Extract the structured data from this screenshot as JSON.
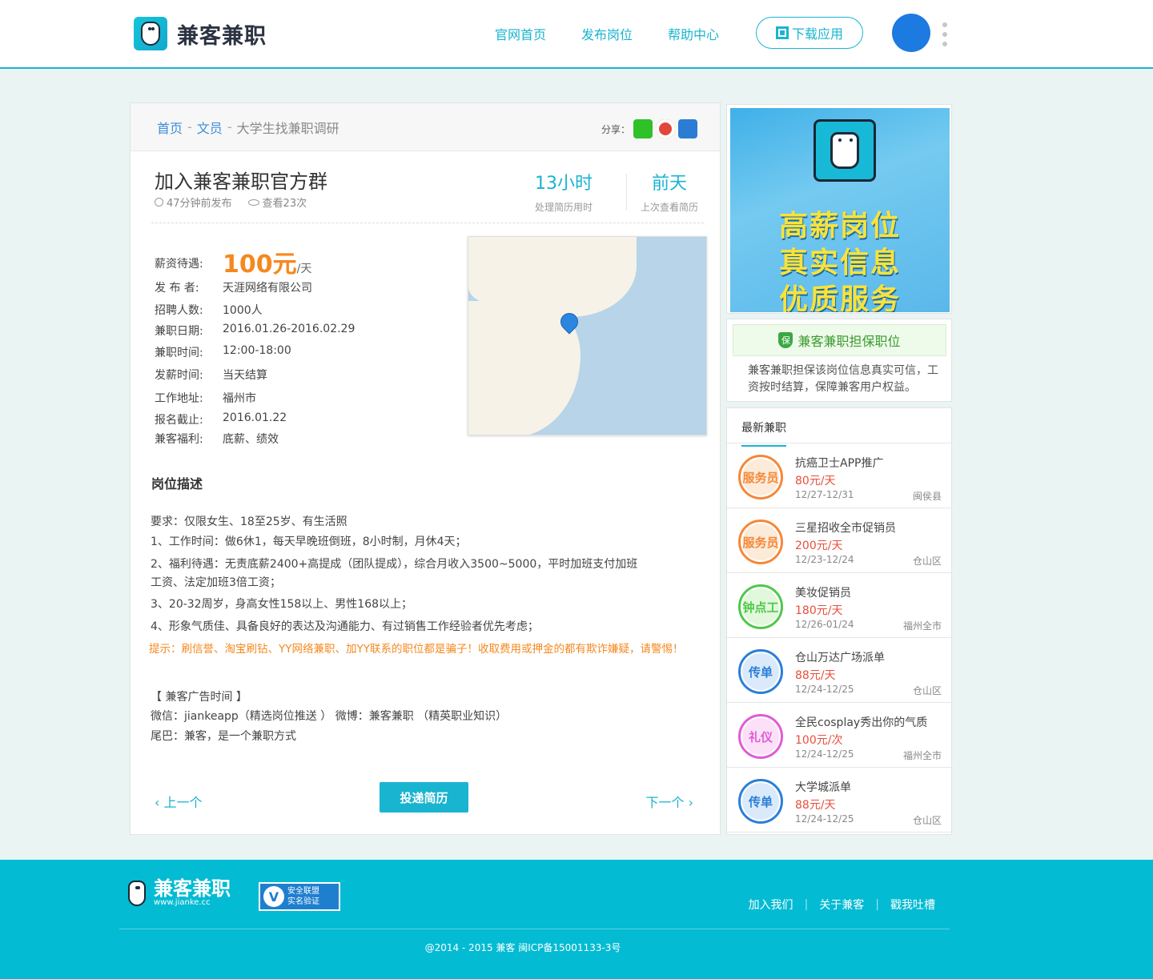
{
  "header": {
    "brand": "兼客兼职",
    "nav": [
      "官网首页",
      "发布岗位",
      "帮助中心"
    ],
    "download_label": "下载应用"
  },
  "breadcrumb": {
    "home": "首页",
    "sep": "-",
    "category": "文员",
    "current": "大学生找兼职调研"
  },
  "share": {
    "label": "分享："
  },
  "job": {
    "title": "加入兼客兼职官方群",
    "posted": "47分钟前发布",
    "views": "查看23次",
    "stat1_value": "13小时",
    "stat1_label": "处理简历用时",
    "stat2_value": "前天",
    "stat2_label": "上次查看简历",
    "salary_label": "薪资待遇:",
    "salary_value": "100元",
    "salary_unit": "/天",
    "publisher_label": "发 布 者:",
    "publisher": "天涯网络有限公司",
    "headcount_label": "招聘人数:",
    "headcount": "1000人",
    "date_label": "兼职日期:",
    "date": "2016.01.26-2016.02.29",
    "time_label": "兼职时间:",
    "time": "12:00-18:00",
    "pay_label": "发薪时间:",
    "pay": "当天结算",
    "address_label": "工作地址:",
    "address": "福州市",
    "deadline_label": "报名截止:",
    "deadline": "2016.01.22",
    "welfare_label": "兼客福利:",
    "welfare": "底薪、绩效"
  },
  "description": {
    "heading": "岗位描述",
    "lines": [
      "要求：仅限女生、18至25岁、有生活照",
      "1、工作时间：做6休1，每天早晚班倒班，8小时制，月休4天；",
      "2、福利待遇：无责底薪2400+高提成（团队提成），综合月收入3500~5000，平时加班支付加班",
      "工资、法定加班3倍工资；",
      "3、20-32周岁，身高女性158以上、男性168以上；",
      "4、形象气质佳、具备良好的表达及沟通能力、有过销售工作经验者优先考虑；"
    ],
    "warning": "提示：刷信誉、淘宝刷钻、YY网络兼职、加YY联系的职位都是骗子！收取费用或押金的都有欺诈嫌疑，请警惕！",
    "ad_title": "【 兼客广告时间 】",
    "ad_line1": "微信：jiankeapp（精选岗位推送 ）  微博：兼客兼职  （精英职业知识）",
    "ad_line2": "尾巴：兼客，是一个兼职方式"
  },
  "actions": {
    "prev": "上一个",
    "submit": "投递简历",
    "next": "下一个"
  },
  "banner": {
    "line1": "高薪岗位",
    "line2": "真实信息",
    "line3": "优质服务"
  },
  "guarantee": {
    "icon_text": "保",
    "title": "兼客兼职担保职位",
    "text": "兼客兼职担保该岗位信息真实可信，工资按时结算，保障兼客用户权益。"
  },
  "latest": {
    "title": "最新兼职",
    "items": [
      {
        "badge": "服务员",
        "color": "#f5883a",
        "bg": "#fdebd9",
        "title": "抗癌卫士APP推广",
        "price": "80元/天",
        "date": "12/27-12/31",
        "loc": "闽侯县"
      },
      {
        "badge": "服务员",
        "color": "#f5883a",
        "bg": "#fdebd9",
        "title": "三星招收全市促销员",
        "price": "200元/天",
        "date": "12/23-12/24",
        "loc": "仓山区"
      },
      {
        "badge": "钟点工",
        "color": "#4fc84a",
        "bg": "#e2f8dd",
        "title": "美妆促销员",
        "price": "180元/天",
        "date": "12/26-01/24",
        "loc": "福州全市"
      },
      {
        "badge": "传单",
        "color": "#2a7fd8",
        "bg": "#dbeafb",
        "title": "仓山万达广场派单",
        "price": "88元/天",
        "date": "12/24-12/25",
        "loc": "仓山区"
      },
      {
        "badge": "礼仪",
        "color": "#e35ad6",
        "bg": "#fbe1f8",
        "title": "全民cosplay秀出你的气质",
        "price": "100元/次",
        "date": "12/24-12/25",
        "loc": "福州全市"
      },
      {
        "badge": "传单",
        "color": "#2a7fd8",
        "bg": "#dbeafb",
        "title": "大学城派单",
        "price": "88元/天",
        "date": "12/24-12/25",
        "loc": "仓山区"
      }
    ]
  },
  "footer": {
    "brand": "兼客兼职",
    "url": "www.jianke.cc",
    "cert_line1": "安全联盟",
    "cert_line2": "实名验证",
    "links": [
      "加入我们",
      "关于兼客",
      "戳我吐槽"
    ],
    "copyright": "@2014 - 2015  兼客  闽ICP备15001133-3号"
  }
}
